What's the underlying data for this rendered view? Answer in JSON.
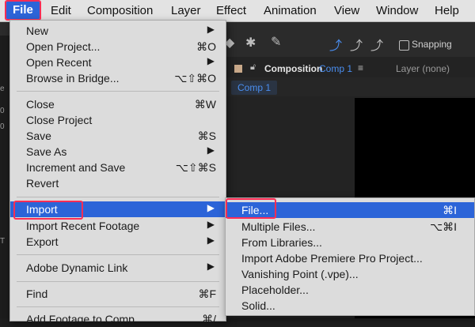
{
  "menubar": {
    "items": [
      "File",
      "Edit",
      "Composition",
      "Layer",
      "Effect",
      "Animation",
      "View",
      "Window",
      "Help"
    ]
  },
  "toolbar": {
    "snapping_label": "Snapping"
  },
  "composition_panel": {
    "prefix": "Composition",
    "name": "Comp 1",
    "tab": "Comp 1",
    "layer_label": "Layer (none)"
  },
  "file_menu": {
    "items": [
      {
        "label": "New",
        "shortcut": "",
        "submenu": true
      },
      {
        "label": "Open Project...",
        "shortcut": "⌘O",
        "submenu": false
      },
      {
        "label": "Open Recent",
        "shortcut": "",
        "submenu": true
      },
      {
        "label": "Browse in Bridge...",
        "shortcut": "⌥⇧⌘O",
        "submenu": false
      },
      {
        "label": "Close",
        "shortcut": "⌘W",
        "submenu": false
      },
      {
        "label": "Close Project",
        "shortcut": "",
        "submenu": false
      },
      {
        "label": "Save",
        "shortcut": "⌘S",
        "submenu": false
      },
      {
        "label": "Save As",
        "shortcut": "",
        "submenu": true
      },
      {
        "label": "Increment and Save",
        "shortcut": "⌥⇧⌘S",
        "submenu": false
      },
      {
        "label": "Revert",
        "shortcut": "",
        "submenu": false
      },
      {
        "label": "Import",
        "shortcut": "",
        "submenu": true
      },
      {
        "label": "Import Recent Footage",
        "shortcut": "",
        "submenu": true
      },
      {
        "label": "Export",
        "shortcut": "",
        "submenu": true
      },
      {
        "label": "Adobe Dynamic Link",
        "shortcut": "",
        "submenu": true
      },
      {
        "label": "Find",
        "shortcut": "⌘F",
        "submenu": false
      },
      {
        "label": "Add Footage to Comp",
        "shortcut": "⌘/",
        "submenu": false
      }
    ]
  },
  "import_submenu": {
    "items": [
      {
        "label": "File...",
        "shortcut": "⌘I"
      },
      {
        "label": "Multiple Files...",
        "shortcut": "⌥⌘I"
      },
      {
        "label": "From Libraries...",
        "shortcut": ""
      },
      {
        "label": "Import Adobe Premiere Pro Project...",
        "shortcut": ""
      },
      {
        "label": "Vanishing Point (.vpe)...",
        "shortcut": ""
      },
      {
        "label": "Placeholder...",
        "shortcut": ""
      },
      {
        "label": "Solid...",
        "shortcut": ""
      }
    ]
  },
  "colors": {
    "highlight": "#2c64d8",
    "annotation_outline": "#ff2d55",
    "accent_blue": "#4a8ef0"
  }
}
